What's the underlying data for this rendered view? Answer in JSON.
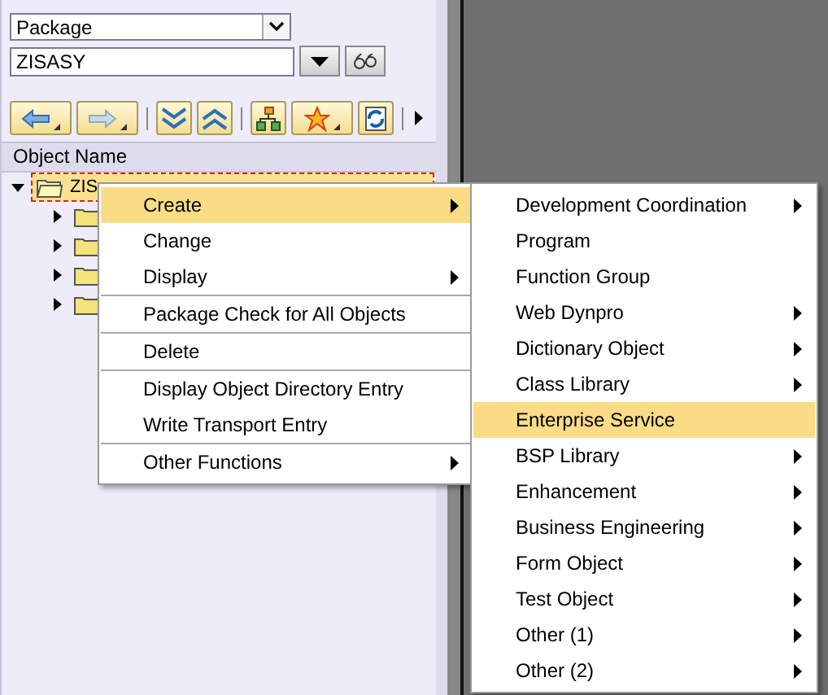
{
  "object_type": {
    "value": "Package"
  },
  "object_name": {
    "value": "ZISASY"
  },
  "tree": {
    "header": "Object Name",
    "items": [
      {
        "label": "ZIS",
        "expanded": true,
        "selected": true,
        "children": [
          {
            "expanded": false
          },
          {
            "expanded": false
          },
          {
            "expanded": false
          },
          {
            "expanded": false
          }
        ]
      }
    ]
  },
  "context_menu": [
    {
      "label": "Create",
      "submenu": true,
      "selected": true,
      "separator_after": false
    },
    {
      "label": "Change",
      "submenu": false,
      "selected": false,
      "separator_after": false
    },
    {
      "label": "Display",
      "submenu": true,
      "selected": false,
      "separator_after": true
    },
    {
      "label": "Package Check for All Objects",
      "submenu": false,
      "selected": false,
      "separator_after": true
    },
    {
      "label": "Delete",
      "submenu": false,
      "selected": false,
      "separator_after": true
    },
    {
      "label": "Display Object Directory Entry",
      "submenu": false,
      "selected": false,
      "separator_after": false
    },
    {
      "label": "Write Transport Entry",
      "submenu": false,
      "selected": false,
      "separator_after": true
    },
    {
      "label": "Other Functions",
      "submenu": true,
      "selected": false,
      "separator_after": false
    }
  ],
  "create_submenu": [
    {
      "label": "Development Coordination",
      "submenu": true,
      "selected": false
    },
    {
      "label": "Program",
      "submenu": false,
      "selected": false
    },
    {
      "label": "Function Group",
      "submenu": false,
      "selected": false
    },
    {
      "label": "Web Dynpro",
      "submenu": true,
      "selected": false
    },
    {
      "label": "Dictionary Object",
      "submenu": true,
      "selected": false
    },
    {
      "label": "Class Library",
      "submenu": true,
      "selected": false
    },
    {
      "label": "Enterprise Service",
      "submenu": false,
      "selected": true
    },
    {
      "label": "BSP Library",
      "submenu": true,
      "selected": false
    },
    {
      "label": "Enhancement",
      "submenu": true,
      "selected": false
    },
    {
      "label": "Business Engineering",
      "submenu": true,
      "selected": false
    },
    {
      "label": "Form Object",
      "submenu": true,
      "selected": false
    },
    {
      "label": "Test Object",
      "submenu": true,
      "selected": false
    },
    {
      "label": "Other (1)",
      "submenu": true,
      "selected": false
    },
    {
      "label": "Other (2)",
      "submenu": true,
      "selected": false
    }
  ]
}
